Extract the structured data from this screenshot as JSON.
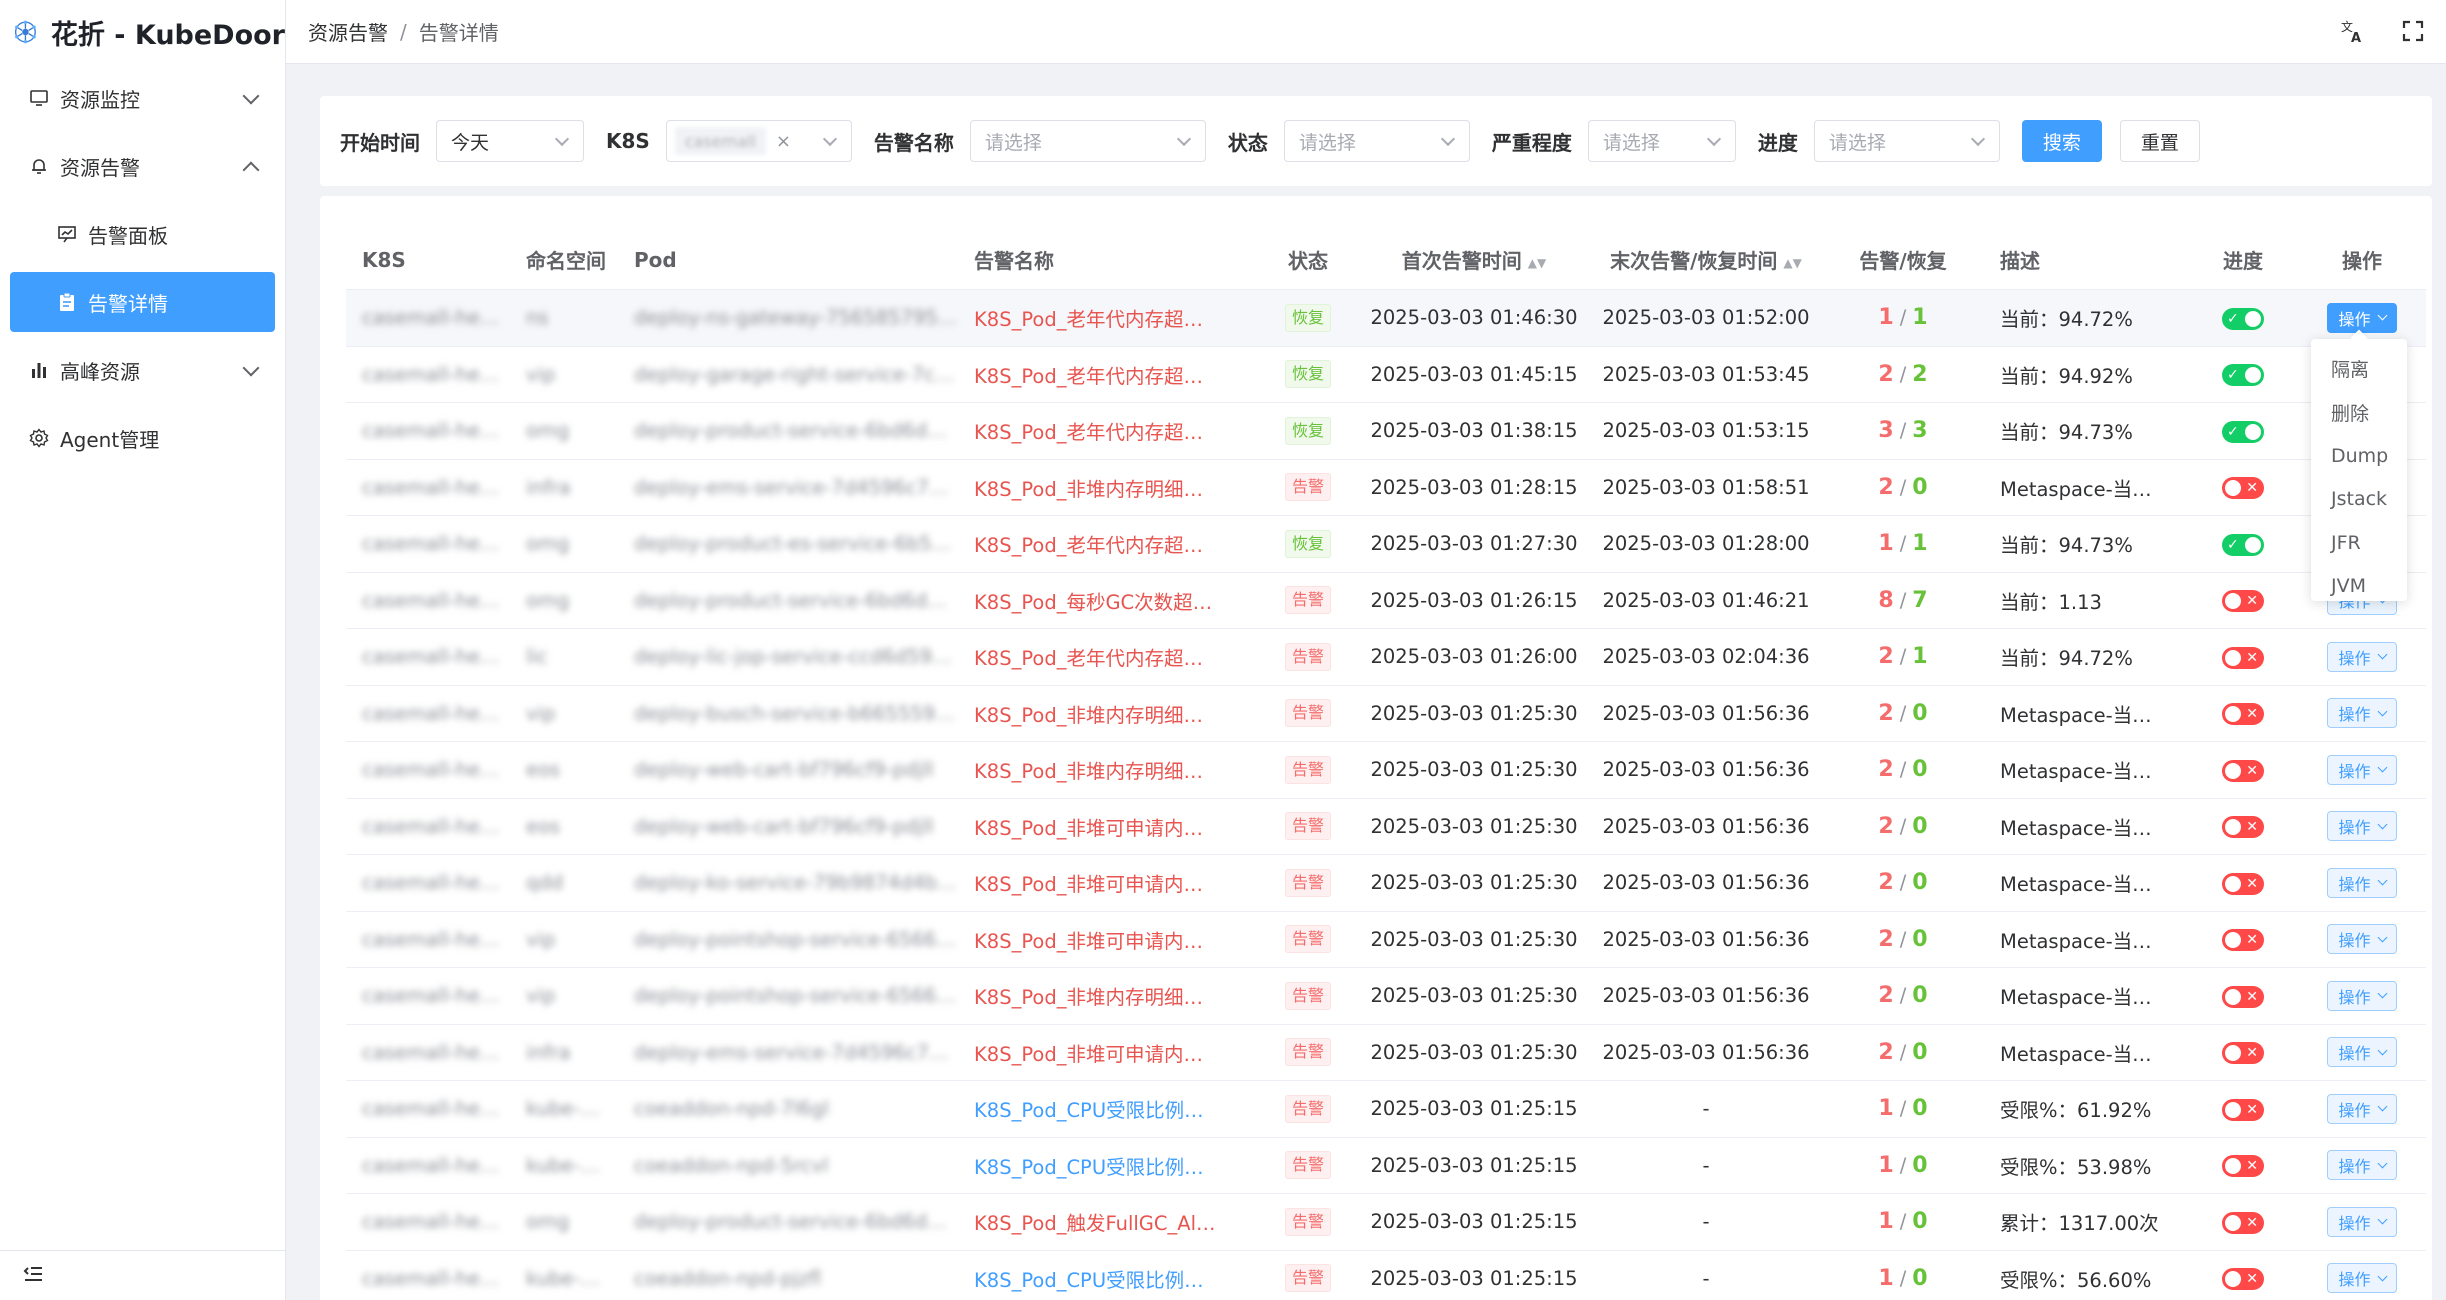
{
  "app": {
    "title": "花折 - KubeDoor"
  },
  "sidebar": {
    "items": [
      {
        "label": "资源监控",
        "icon": "monitor-icon"
      },
      {
        "label": "资源告警",
        "icon": "bell-icon"
      },
      {
        "label": "告警面板",
        "icon": "presentation-chart-icon"
      },
      {
        "label": "告警详情",
        "icon": "clipboard-icon"
      },
      {
        "label": "高峰资源",
        "icon": "bar-chart-icon"
      },
      {
        "label": "Agent管理",
        "icon": "gear-icon"
      }
    ]
  },
  "header": {
    "breadcrumb": [
      "资源告警",
      "告警详情"
    ],
    "breadcrumb_sep": "/"
  },
  "filters": {
    "start_time": {
      "label": "开始时间",
      "value": "今天"
    },
    "k8s": {
      "label": "K8S",
      "tag": "casemall",
      "close": "×"
    },
    "alert_name": {
      "label": "告警名称",
      "placeholder": "请选择"
    },
    "status": {
      "label": "状态",
      "placeholder": "请选择"
    },
    "severity": {
      "label": "严重程度",
      "placeholder": "请选择"
    },
    "progress": {
      "label": "进度",
      "placeholder": "请选择"
    },
    "search_label": "搜索",
    "reset_label": "重置"
  },
  "table": {
    "columns": [
      "K8S",
      "命名空间",
      "Pod",
      "告警名称",
      "状态",
      "首次告警时间",
      "末次告警/恢复时间",
      "告警/恢复",
      "描述",
      "进度",
      "操作"
    ],
    "sort_glyph": "▲▼",
    "op_label": "操作",
    "rows": [
      {
        "k8s": "casemall-he…",
        "ns": "ns",
        "pod": "deploy-ns-gateway-7565857958-4…",
        "name": "K8S_Pod_老年代内存超…",
        "name_color": "red",
        "status": "恢复",
        "first": "2025-03-03 01:46:30",
        "last": "2025-03-03 01:52:00",
        "alert": "1",
        "recover": "1",
        "desc": "当前：94.72%",
        "progress": "on"
      },
      {
        "k8s": "casemall-he…",
        "ns": "vip",
        "pod": "deploy-garage-right-service-7c89…",
        "name": "K8S_Pod_老年代内存超…",
        "name_color": "red",
        "status": "恢复",
        "first": "2025-03-03 01:45:15",
        "last": "2025-03-03 01:53:45",
        "alert": "2",
        "recover": "2",
        "desc": "当前：94.92%",
        "progress": "on"
      },
      {
        "k8s": "casemall-he…",
        "ns": "omg",
        "pod": "deploy-product-service-6bd6d4cf…",
        "name": "K8S_Pod_老年代内存超…",
        "name_color": "red",
        "status": "恢复",
        "first": "2025-03-03 01:38:15",
        "last": "2025-03-03 01:53:15",
        "alert": "3",
        "recover": "3",
        "desc": "当前：94.73%",
        "progress": "on"
      },
      {
        "k8s": "casemall-he…",
        "ns": "infra",
        "pod": "deploy-ems-service-7d4596c796-…",
        "name": "K8S_Pod_非堆内存明细…",
        "name_color": "red",
        "status": "告警",
        "first": "2025-03-03 01:28:15",
        "last": "2025-03-03 01:58:51",
        "alert": "2",
        "recover": "0",
        "desc": "Metaspace-当…",
        "progress": "off"
      },
      {
        "k8s": "casemall-he…",
        "ns": "omg",
        "pod": "deploy-product-es-service-6b5677…",
        "name": "K8S_Pod_老年代内存超…",
        "name_color": "red",
        "status": "恢复",
        "first": "2025-03-03 01:27:30",
        "last": "2025-03-03 01:28:00",
        "alert": "1",
        "recover": "1",
        "desc": "当前：94.73%",
        "progress": "on"
      },
      {
        "k8s": "casemall-he…",
        "ns": "omg",
        "pod": "deploy-product-service-6bd6d4cf…",
        "name": "K8S_Pod_每秒GC次数超…",
        "name_color": "red",
        "status": "告警",
        "first": "2025-03-03 01:26:15",
        "last": "2025-03-03 01:46:21",
        "alert": "8",
        "recover": "7",
        "desc": "当前：1.13",
        "progress": "off"
      },
      {
        "k8s": "casemall-he…",
        "ns": "lic",
        "pod": "deploy-lic-jop-service-ccd6d599-…",
        "name": "K8S_Pod_老年代内存超…",
        "name_color": "red",
        "status": "告警",
        "first": "2025-03-03 01:26:00",
        "last": "2025-03-03 02:04:36",
        "alert": "2",
        "recover": "1",
        "desc": "当前：94.72%",
        "progress": "off"
      },
      {
        "k8s": "casemall-he…",
        "ns": "vip",
        "pod": "deploy-busch-service-b6655599-…",
        "name": "K8S_Pod_非堆内存明细…",
        "name_color": "red",
        "status": "告警",
        "first": "2025-03-03 01:25:30",
        "last": "2025-03-03 01:56:36",
        "alert": "2",
        "recover": "0",
        "desc": "Metaspace-当…",
        "progress": "off"
      },
      {
        "k8s": "casemall-he…",
        "ns": "eos",
        "pod": "deploy-web-cart-bf796cf9-pdjll",
        "name": "K8S_Pod_非堆内存明细…",
        "name_color": "red",
        "status": "告警",
        "first": "2025-03-03 01:25:30",
        "last": "2025-03-03 01:56:36",
        "alert": "2",
        "recover": "0",
        "desc": "Metaspace-当…",
        "progress": "off"
      },
      {
        "k8s": "casemall-he…",
        "ns": "eos",
        "pod": "deploy-web-cart-bf796cf9-pdjll",
        "name": "K8S_Pod_非堆可申请内…",
        "name_color": "red",
        "status": "告警",
        "first": "2025-03-03 01:25:30",
        "last": "2025-03-03 01:56:36",
        "alert": "2",
        "recover": "0",
        "desc": "Metaspace-当…",
        "progress": "off"
      },
      {
        "k8s": "casemall-he…",
        "ns": "qdd",
        "pod": "deploy-ko-service-79b9874d4b-5…",
        "name": "K8S_Pod_非堆可申请内…",
        "name_color": "red",
        "status": "告警",
        "first": "2025-03-03 01:25:30",
        "last": "2025-03-03 01:56:36",
        "alert": "2",
        "recover": "0",
        "desc": "Metaspace-当…",
        "progress": "off"
      },
      {
        "k8s": "casemall-he…",
        "ns": "vip",
        "pod": "deploy-pointshop-service-6566b…",
        "name": "K8S_Pod_非堆可申请内…",
        "name_color": "red",
        "status": "告警",
        "first": "2025-03-03 01:25:30",
        "last": "2025-03-03 01:56:36",
        "alert": "2",
        "recover": "0",
        "desc": "Metaspace-当…",
        "progress": "off"
      },
      {
        "k8s": "casemall-he…",
        "ns": "vip",
        "pod": "deploy-pointshop-service-6566b…",
        "name": "K8S_Pod_非堆内存明细…",
        "name_color": "red",
        "status": "告警",
        "first": "2025-03-03 01:25:30",
        "last": "2025-03-03 01:56:36",
        "alert": "2",
        "recover": "0",
        "desc": "Metaspace-当…",
        "progress": "off"
      },
      {
        "k8s": "casemall-he…",
        "ns": "infra",
        "pod": "deploy-ems-service-7d4596c796-…",
        "name": "K8S_Pod_非堆可申请内…",
        "name_color": "red",
        "status": "告警",
        "first": "2025-03-03 01:25:30",
        "last": "2025-03-03 01:56:36",
        "alert": "2",
        "recover": "0",
        "desc": "Metaspace-当…",
        "progress": "off"
      },
      {
        "k8s": "casemall-he…",
        "ns": "kube-…",
        "pod": "coeaddon-npd-7l6gl",
        "name": "K8S_Pod_CPU受限比例…",
        "name_color": "blue",
        "status": "告警",
        "first": "2025-03-03 01:25:15",
        "last": "-",
        "alert": "1",
        "recover": "0",
        "desc": "受限%：61.92%",
        "progress": "off"
      },
      {
        "k8s": "casemall-he…",
        "ns": "kube-…",
        "pod": "coeaddon-npd-5rcvl",
        "name": "K8S_Pod_CPU受限比例…",
        "name_color": "blue",
        "status": "告警",
        "first": "2025-03-03 01:25:15",
        "last": "-",
        "alert": "1",
        "recover": "0",
        "desc": "受限%：53.98%",
        "progress": "off"
      },
      {
        "k8s": "casemall-he…",
        "ns": "omg",
        "pod": "deploy-product-service-6bd6d4cf…",
        "name": "K8S_Pod_触发FullGC_Al…",
        "name_color": "red",
        "status": "告警",
        "first": "2025-03-03 01:25:15",
        "last": "-",
        "alert": "1",
        "recover": "0",
        "desc": "累计：1317.00次",
        "progress": "off"
      },
      {
        "k8s": "casemall-he…",
        "ns": "kube-…",
        "pod": "coeaddon-npd-pjzfl",
        "name": "K8S_Pod_CPU受限比例…",
        "name_color": "blue",
        "status": "告警",
        "first": "2025-03-03 01:25:15",
        "last": "-",
        "alert": "1",
        "recover": "0",
        "desc": "受限%：56.60%",
        "progress": "off"
      }
    ]
  },
  "op_menu": {
    "items": [
      "隔离",
      "删除",
      "Dump",
      "Jstack",
      "JFR",
      "JVM"
    ]
  },
  "colors": {
    "primary": "#409eff",
    "danger": "#f56c6c",
    "success": "#67c23a",
    "switch_on": "#13ce66",
    "switch_off": "#ff4949"
  }
}
